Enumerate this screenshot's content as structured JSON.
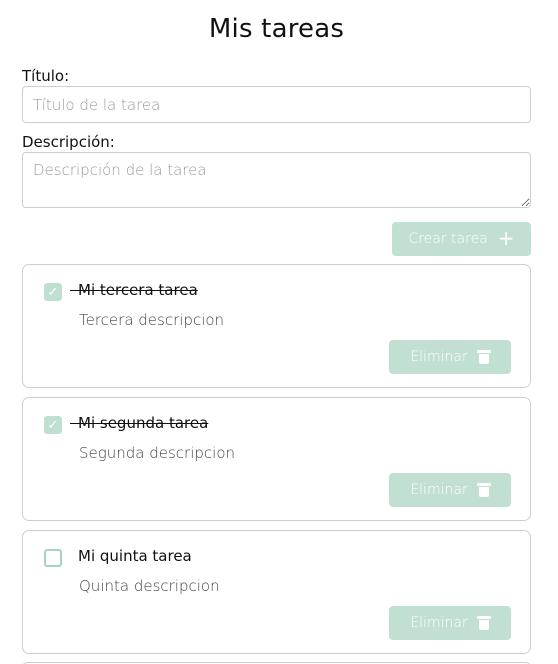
{
  "header": {
    "title": "Mis tareas"
  },
  "form": {
    "title_label": "Título:",
    "title_placeholder": "Título de la tarea",
    "desc_label": "Descripción:",
    "desc_placeholder": "Descripción de la tarea",
    "create_label": "Crear tarea",
    "create_icon": "+"
  },
  "tasks": [
    {
      "title": "Mi tercera tarea",
      "description": "Tercera descripcion",
      "done": true,
      "delete_label": "Eliminar"
    },
    {
      "title": "Mi segunda tarea",
      "description": "Segunda descripcion",
      "done": true,
      "delete_label": "Eliminar"
    },
    {
      "title": "Mi quinta tarea",
      "description": "Quinta descripcion",
      "done": false,
      "delete_label": "Eliminar"
    }
  ],
  "colors": {
    "accent": "#c1e0d2",
    "border": "#cfcfcf"
  },
  "icons": {
    "check": "check-icon",
    "trash": "trash-icon",
    "plus": "plus-icon"
  }
}
